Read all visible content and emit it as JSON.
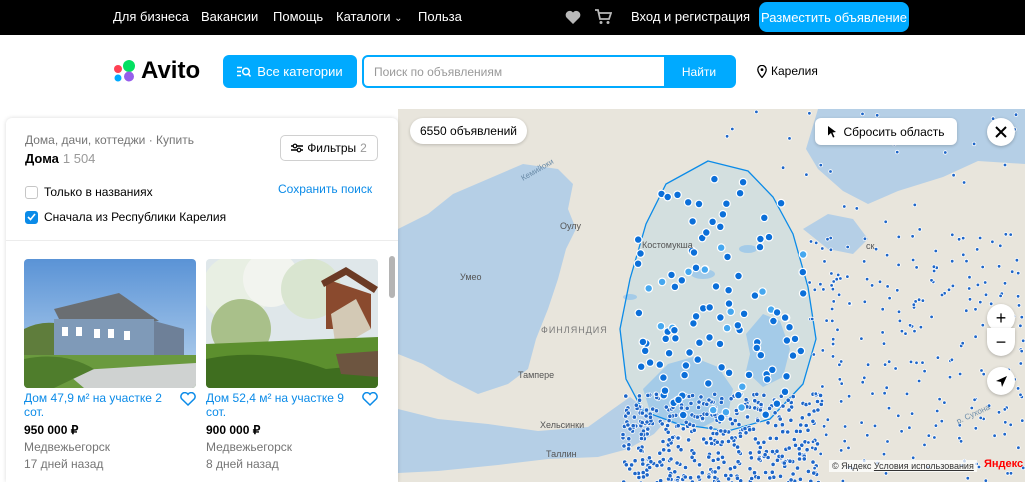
{
  "topbar": {
    "nav": [
      "Для бизнеса",
      "Вакансии",
      "Помощь",
      "Каталоги",
      "Польза"
    ],
    "catalogs_chevron": "⌄",
    "login": "Вход и регистрация",
    "post_ad": "Разместить объявление"
  },
  "header": {
    "logo": "Avito",
    "all_categories": "Все категории",
    "search_placeholder": "Поиск по объявлениям",
    "search_button": "Найти",
    "region": "Карелия"
  },
  "panel": {
    "breadcrumb": "Дома, дачи, коттеджи · Купить",
    "title": "Дома",
    "count": "1 504",
    "filters_label": "Фильтры",
    "filters_count": "2",
    "only_in_titles": "Только в названиях",
    "karelia_first": "Сначала из Республики Карелия",
    "save_search": "Сохранить поиск"
  },
  "listings": [
    {
      "title": "Дом 47,9 м² на участке 2 сот.",
      "price": "950 000 ₽",
      "city": "Медвежьегорск",
      "date": "17 дней назад"
    },
    {
      "title": "Дом 52,4 м² на участке 9 сот.",
      "price": "900 000 ₽",
      "city": "Медвежьегорск",
      "date": "8 дней назад"
    }
  ],
  "map": {
    "count": "6550 объявлений",
    "reset_area": "Сбросить область",
    "zoom_in": "+",
    "zoom_out": "−",
    "labels": {
      "finland": "ФИНЛЯНДИЯ",
      "oulu": "Оулу",
      "kostomuksha": "Костомукша",
      "umeo": "Умео",
      "tampere": "Тампере",
      "helsinki": "Хельсинки",
      "tallinn": "Таллин",
      "kemijoki": "Кемийоки",
      "sukhona": "р. Сухона",
      "severodvinsk": "ск"
    },
    "attribution": "© Яндекс",
    "terms": "Условия использования",
    "yandex": "Яндекс"
  },
  "colors": {
    "accent": "#00aaff",
    "link": "#0b8be8",
    "marker": "#0b6fd9",
    "dot": "#1e66c8",
    "water": "#b5cfe6",
    "land": "#e9e6dd"
  }
}
